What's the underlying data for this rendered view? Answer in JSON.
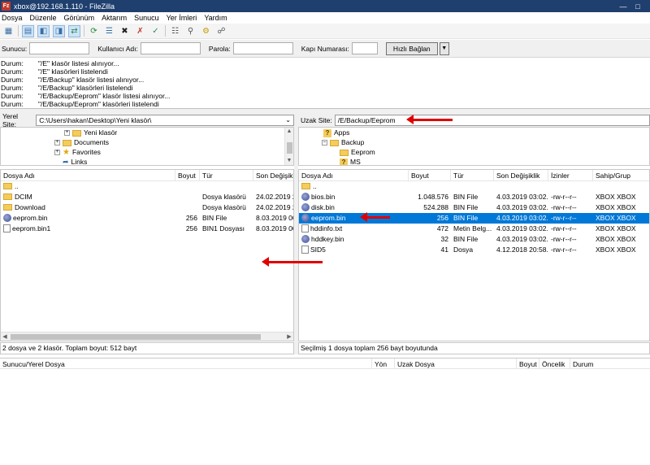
{
  "window": {
    "title": "xbox@192.168.1.110 - FileZilla",
    "app_icon": "Fz"
  },
  "menu": [
    "Dosya",
    "Düzenle",
    "Görünüm",
    "Aktarım",
    "Sunucu",
    "Yer İmleri",
    "Yardım"
  ],
  "quickconnect": {
    "host_label": "Sunucu:",
    "user_label": "Kullanıcı Adı:",
    "pass_label": "Parola:",
    "port_label": "Kapı Numarası:",
    "connect_label": "Hızlı Bağlan"
  },
  "log": [
    {
      "tag": "Durum:",
      "msg": "\"/E\" klasör listesi alınıyor..."
    },
    {
      "tag": "Durum:",
      "msg": "\"/E\" klasörleri listelendi"
    },
    {
      "tag": "Durum:",
      "msg": "\"/E/Backup\" klasör listesi alınıyor..."
    },
    {
      "tag": "Durum:",
      "msg": "\"/E/Backup\" klasörleri listelendi"
    },
    {
      "tag": "Durum:",
      "msg": "\"/E/Backup/Eeprom\" klasör listesi alınıyor..."
    },
    {
      "tag": "Durum:",
      "msg": "\"/E/Backup/Eeprom\" klasörleri listelendi"
    }
  ],
  "local": {
    "site_label": "Yerel Site:",
    "path": "C:\\Users\\hakan\\Desktop\\Yeni klasör\\",
    "tree": [
      "Yeni klasör",
      "Documents",
      "Favorites",
      "Links"
    ],
    "columns": [
      "Dosya Adı",
      "Boyut",
      "Tür",
      "Son Değişikli"
    ],
    "files": [
      {
        "name": "..",
        "size": "",
        "type": "",
        "modified": ""
      },
      {
        "name": "DCIM",
        "size": "",
        "type": "Dosya klasörü",
        "modified": "24.02.2019 22"
      },
      {
        "name": "Download",
        "size": "",
        "type": "Dosya klasörü",
        "modified": "24.02.2019 22"
      },
      {
        "name": "eeprom.bin",
        "size": "256",
        "type": "BIN File",
        "modified": "8.03.2019 00:"
      },
      {
        "name": "eeprom.bin1",
        "size": "256",
        "type": "BIN1 Dosyası",
        "modified": "8.03.2019 00:"
      }
    ],
    "status": "2 dosya ve 2 klasör. Toplam boyut: 512 bayt"
  },
  "remote": {
    "site_label": "Uzak Site:",
    "path": "/E/Backup/Eeprom",
    "tree": [
      "Apps",
      "Backup",
      "Eeprom",
      "MS"
    ],
    "columns": [
      "Dosya Adı",
      "Boyut",
      "Tür",
      "Son Değişiklik",
      "İzinler",
      "Sahip/Grup"
    ],
    "files": [
      {
        "name": "..",
        "size": "",
        "type": "",
        "modified": "",
        "perms": "",
        "owner": ""
      },
      {
        "name": "bios.bin",
        "size": "1.048.576",
        "type": "BIN File",
        "modified": "4.03.2019 03:02...",
        "perms": "-rw-r--r--",
        "owner": "XBOX XBOX"
      },
      {
        "name": "disk.bin",
        "size": "524.288",
        "type": "BIN File",
        "modified": "4.03.2019 03:02...",
        "perms": "-rw-r--r--",
        "owner": "XBOX XBOX"
      },
      {
        "name": "eeprom.bin",
        "size": "256",
        "type": "BIN File",
        "modified": "4.03.2019 03:02...",
        "perms": "-rw-r--r--",
        "owner": "XBOX XBOX"
      },
      {
        "name": "hddinfo.txt",
        "size": "472",
        "type": "Metin Belg...",
        "modified": "4.03.2019 03:02...",
        "perms": "-rw-r--r--",
        "owner": "XBOX XBOX"
      },
      {
        "name": "hddkey.bin",
        "size": "32",
        "type": "BIN File",
        "modified": "4.03.2019 03:02...",
        "perms": "-rw-r--r--",
        "owner": "XBOX XBOX"
      },
      {
        "name": "SID5",
        "size": "41",
        "type": "Dosya",
        "modified": "4.12.2018 20:58...",
        "perms": "-rw-r--r--",
        "owner": "XBOX XBOX"
      }
    ],
    "status": "Seçilmiş 1 dosya toplam 256 bayt boyutunda"
  },
  "queue": {
    "columns": [
      "Sunucu/Yerel Dosya",
      "Yön",
      "Uzak Dosya",
      "Boyut",
      "Öncelik",
      "Durum"
    ]
  },
  "colors": {
    "selection": "#0078d7",
    "annotation_arrow": "#e00000",
    "titlebar": "#1f3f6e"
  }
}
